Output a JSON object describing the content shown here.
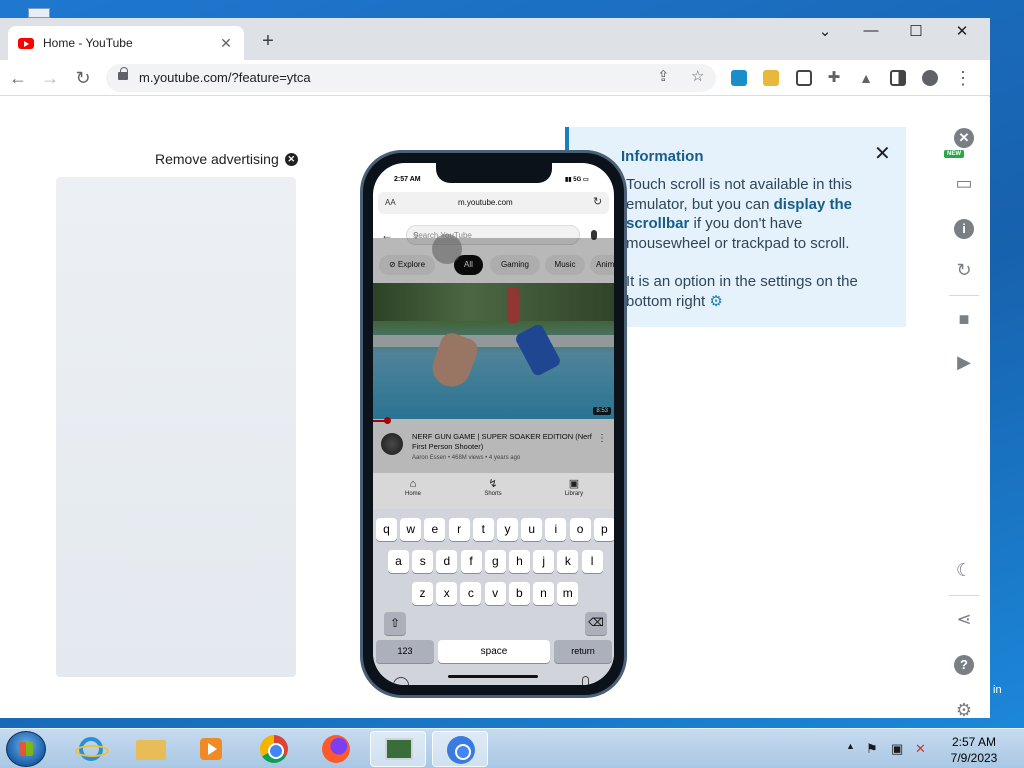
{
  "browser": {
    "tab_title": "Home - YouTube",
    "url": "m.youtube.com/?feature=ytca"
  },
  "page": {
    "remove_ad_label": "Remove advertising",
    "info": {
      "title": "Information",
      "text_1": "Touch scroll is not available in this emulator, but you can",
      "link": "display the scrollbar",
      "text_2": "if you don't have mousewheel or trackpad to scroll.",
      "text_3": "It is an option in the settings on the bottom right"
    },
    "right_bar": {
      "new_badge": "NEW"
    }
  },
  "phone": {
    "time": "2:57 AM",
    "network": "5G",
    "safari_aa": "AA",
    "safari_url": "m.youtube.com",
    "search_placeholder": "Search YouTube",
    "chips": [
      "Explore",
      "All",
      "Gaming",
      "Music",
      "Anim"
    ],
    "active_chip": "All",
    "video": {
      "title": "NERF GUN GAME | SUPER SOAKER EDITION (Nerf First Person Shooter)",
      "meta": "Aaron Essen • 468M views • 4 years ago",
      "duration": "8:53",
      "progress_fraction": 0.06
    },
    "nav": [
      "Home",
      "Shorts",
      "Library"
    ],
    "keyboard": {
      "row1": [
        "q",
        "w",
        "e",
        "r",
        "t",
        "y",
        "u",
        "i",
        "o",
        "p"
      ],
      "row2": [
        "a",
        "s",
        "d",
        "f",
        "g",
        "h",
        "j",
        "k",
        "l"
      ],
      "row3": [
        "z",
        "x",
        "c",
        "v",
        "b",
        "n",
        "m"
      ],
      "numbers_key": "123",
      "space_key": "space",
      "return_key": "return"
    }
  },
  "taskbar": {
    "time": "2:57 AM",
    "date": "7/9/2023"
  },
  "desktop": {
    "partial_label": "in"
  },
  "colors": {
    "accent": "#155e8a",
    "info_bg": "#e6f2fb",
    "youtube_red": "#ff0000"
  }
}
